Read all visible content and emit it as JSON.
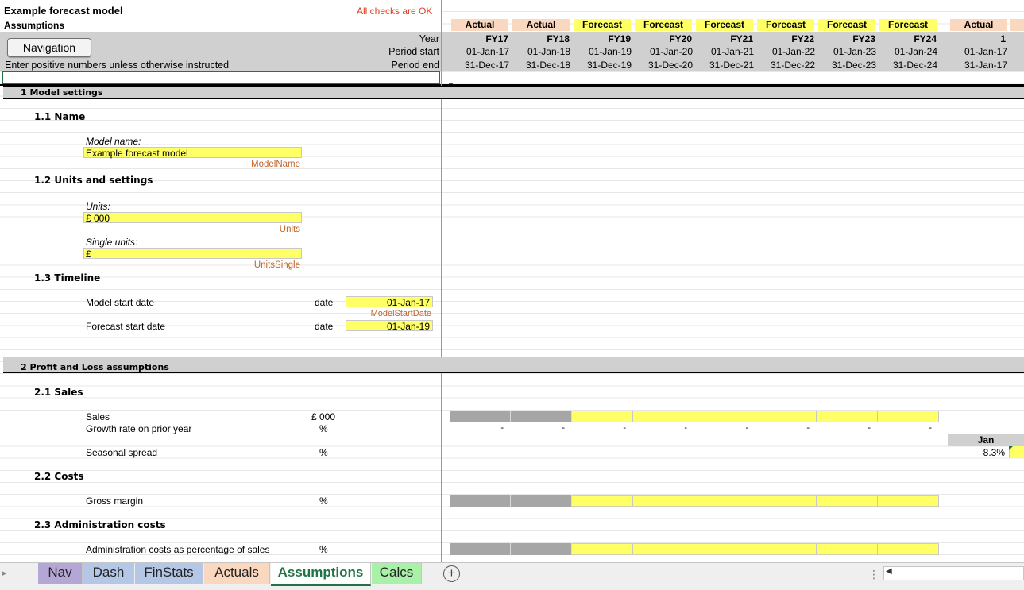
{
  "sheet": {
    "title": "Example forecast model",
    "subtitle": "Assumptions",
    "check_status": "All checks are OK",
    "instruction": "Enter positive numbers unless otherwise instructed",
    "navigation_button": "Navigation",
    "row_labels": {
      "year": "Year",
      "period_start": "Period start",
      "period_end": "Period end"
    }
  },
  "timeline": [
    {
      "type": "Actual",
      "year": "FY17",
      "start": "01-Jan-17",
      "end": "31-Dec-17"
    },
    {
      "type": "Actual",
      "year": "FY18",
      "start": "01-Jan-18",
      "end": "31-Dec-18"
    },
    {
      "type": "Forecast",
      "year": "FY19",
      "start": "01-Jan-19",
      "end": "31-Dec-19"
    },
    {
      "type": "Forecast",
      "year": "FY20",
      "start": "01-Jan-20",
      "end": "31-Dec-20"
    },
    {
      "type": "Forecast",
      "year": "FY21",
      "start": "01-Jan-21",
      "end": "31-Dec-21"
    },
    {
      "type": "Forecast",
      "year": "FY22",
      "start": "01-Jan-22",
      "end": "31-Dec-22"
    },
    {
      "type": "Forecast",
      "year": "FY23",
      "start": "01-Jan-23",
      "end": "31-Dec-23"
    },
    {
      "type": "Forecast",
      "year": "FY24",
      "start": "01-Jan-24",
      "end": "31-Dec-24"
    }
  ],
  "monthly": {
    "type": "Actual",
    "period": "1",
    "start": "01-Jan-17",
    "end": "31-Jan-17",
    "month_label": "Jan",
    "spread_value": "8.3%"
  },
  "sections": {
    "s1": "1 Model settings",
    "s1_1": "1.1 Name",
    "model_name_label": "Model name:",
    "model_name_value": "Example forecast model",
    "model_name_range": "ModelName",
    "s1_2": "1.2 Units and settings",
    "units_label": "Units:",
    "units_value": "£ 000",
    "units_range": "Units",
    "single_units_label": "Single units:",
    "single_units_value": "£",
    "single_units_range": "UnitsSingle",
    "s1_3": "1.3 Timeline",
    "model_start_label": "Model start date",
    "model_start_unit": "date",
    "model_start_value": "01-Jan-17",
    "model_start_range": "ModelStartDate",
    "forecast_start_label": "Forecast start date",
    "forecast_start_unit": "date",
    "forecast_start_value": "01-Jan-19",
    "s2": "2 Profit and Loss assumptions",
    "s2_1": "2.1 Sales",
    "sales_label": "Sales",
    "sales_unit": "£ 000",
    "growth_label": "Growth rate on prior year",
    "growth_unit": "%",
    "growth_values": [
      "-",
      "-",
      "-",
      "-",
      "-",
      "-",
      "-",
      "-"
    ],
    "seasonal_label": "Seasonal spread",
    "seasonal_unit": "%",
    "s2_2": "2.2 Costs",
    "gross_margin_label": "Gross margin",
    "gross_margin_unit": "%",
    "s2_3": "2.3 Administration costs",
    "admin_label": "Administration costs as percentage of sales",
    "admin_unit": "%"
  },
  "tabs": [
    {
      "label": "Nav",
      "color": "#b4a7d6"
    },
    {
      "label": "Dash",
      "color": "#b4c7e7"
    },
    {
      "label": "FinStats",
      "color": "#b4c7e7"
    },
    {
      "label": "Actuals",
      "color": "#fad7bf"
    },
    {
      "label": "Assumptions",
      "color": "#ffffff",
      "active": true
    },
    {
      "label": "Calcs",
      "color": "#a9f0a9"
    }
  ],
  "add_sheet_symbol": "+"
}
